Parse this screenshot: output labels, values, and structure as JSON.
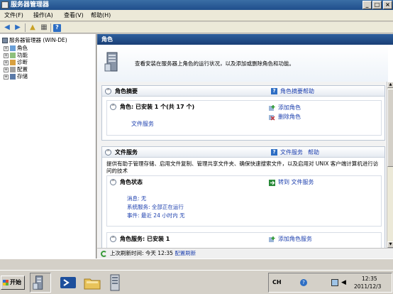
{
  "window": {
    "title": "服务器管理器",
    "menu": [
      "文件(F)",
      "操作(A)",
      "查看(V)",
      "帮助(H)"
    ]
  },
  "toolbar": {
    "icons": [
      "back-arrow-icon",
      "forward-arrow-icon",
      "up-folder-icon",
      "show-hide-tree-icon",
      "help-icon"
    ],
    "help_glyph": "?"
  },
  "tree": {
    "root": "服务器管理器 (WIN-DE)",
    "items": [
      "角色",
      "功能",
      "诊断",
      "配置",
      "存储"
    ]
  },
  "content": {
    "header": "角色",
    "banner_text": "查看安装在服务器上角色的运行状况，以及添加或删除角色和功能。",
    "summary": {
      "title": "角色摘要",
      "help": "角色摘要帮助",
      "roles_line": "角色: 已安装 1 个(共 17 个)",
      "role_item": "文件服务",
      "actions": [
        "添加角色",
        "删除角色"
      ]
    },
    "file_services": {
      "title": "文件服务",
      "help_a": "文件服务",
      "help_b": "帮助",
      "description": "提供有助于管理存储、启用文件复制、管理共享文件夹、确保快速搜索文件，以及启用对 UNIX 客户端计算机进行访问的技术",
      "status_title": "角色状态",
      "goto": "转到 文件服务",
      "msg_label": "消息: ",
      "msg_value": "无",
      "sys_label": "系统服务: ",
      "sys_value": "全部正在运行",
      "evt_label": "事件: ",
      "evt_value": "最近 24 小时内 无",
      "role_services": "角色服务: 已安装 1",
      "add_service": "添加角色服务"
    },
    "status": {
      "label": "上次刷新时间: 今天 12:35",
      "link": "配置刷新"
    }
  },
  "taskbar": {
    "start": "开始",
    "lang": "CH",
    "time": "12:35",
    "date": "2011/12/3"
  },
  "colors": {
    "header_blue": "#1f4e8c",
    "link_blue": "#1c3fae"
  }
}
